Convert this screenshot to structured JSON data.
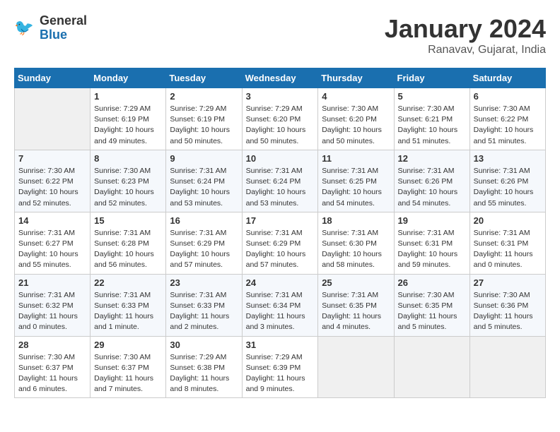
{
  "header": {
    "logo_line1": "General",
    "logo_line2": "Blue",
    "month": "January 2024",
    "location": "Ranavav, Gujarat, India"
  },
  "columns": [
    "Sunday",
    "Monday",
    "Tuesday",
    "Wednesday",
    "Thursday",
    "Friday",
    "Saturday"
  ],
  "weeks": [
    [
      {
        "day": "",
        "info": ""
      },
      {
        "day": "1",
        "info": "Sunrise: 7:29 AM\nSunset: 6:19 PM\nDaylight: 10 hours\nand 49 minutes."
      },
      {
        "day": "2",
        "info": "Sunrise: 7:29 AM\nSunset: 6:19 PM\nDaylight: 10 hours\nand 50 minutes."
      },
      {
        "day": "3",
        "info": "Sunrise: 7:29 AM\nSunset: 6:20 PM\nDaylight: 10 hours\nand 50 minutes."
      },
      {
        "day": "4",
        "info": "Sunrise: 7:30 AM\nSunset: 6:20 PM\nDaylight: 10 hours\nand 50 minutes."
      },
      {
        "day": "5",
        "info": "Sunrise: 7:30 AM\nSunset: 6:21 PM\nDaylight: 10 hours\nand 51 minutes."
      },
      {
        "day": "6",
        "info": "Sunrise: 7:30 AM\nSunset: 6:22 PM\nDaylight: 10 hours\nand 51 minutes."
      }
    ],
    [
      {
        "day": "7",
        "info": "Sunrise: 7:30 AM\nSunset: 6:22 PM\nDaylight: 10 hours\nand 52 minutes."
      },
      {
        "day": "8",
        "info": "Sunrise: 7:30 AM\nSunset: 6:23 PM\nDaylight: 10 hours\nand 52 minutes."
      },
      {
        "day": "9",
        "info": "Sunrise: 7:31 AM\nSunset: 6:24 PM\nDaylight: 10 hours\nand 53 minutes."
      },
      {
        "day": "10",
        "info": "Sunrise: 7:31 AM\nSunset: 6:24 PM\nDaylight: 10 hours\nand 53 minutes."
      },
      {
        "day": "11",
        "info": "Sunrise: 7:31 AM\nSunset: 6:25 PM\nDaylight: 10 hours\nand 54 minutes."
      },
      {
        "day": "12",
        "info": "Sunrise: 7:31 AM\nSunset: 6:26 PM\nDaylight: 10 hours\nand 54 minutes."
      },
      {
        "day": "13",
        "info": "Sunrise: 7:31 AM\nSunset: 6:26 PM\nDaylight: 10 hours\nand 55 minutes."
      }
    ],
    [
      {
        "day": "14",
        "info": "Sunrise: 7:31 AM\nSunset: 6:27 PM\nDaylight: 10 hours\nand 55 minutes."
      },
      {
        "day": "15",
        "info": "Sunrise: 7:31 AM\nSunset: 6:28 PM\nDaylight: 10 hours\nand 56 minutes."
      },
      {
        "day": "16",
        "info": "Sunrise: 7:31 AM\nSunset: 6:29 PM\nDaylight: 10 hours\nand 57 minutes."
      },
      {
        "day": "17",
        "info": "Sunrise: 7:31 AM\nSunset: 6:29 PM\nDaylight: 10 hours\nand 57 minutes."
      },
      {
        "day": "18",
        "info": "Sunrise: 7:31 AM\nSunset: 6:30 PM\nDaylight: 10 hours\nand 58 minutes."
      },
      {
        "day": "19",
        "info": "Sunrise: 7:31 AM\nSunset: 6:31 PM\nDaylight: 10 hours\nand 59 minutes."
      },
      {
        "day": "20",
        "info": "Sunrise: 7:31 AM\nSunset: 6:31 PM\nDaylight: 11 hours\nand 0 minutes."
      }
    ],
    [
      {
        "day": "21",
        "info": "Sunrise: 7:31 AM\nSunset: 6:32 PM\nDaylight: 11 hours\nand 0 minutes."
      },
      {
        "day": "22",
        "info": "Sunrise: 7:31 AM\nSunset: 6:33 PM\nDaylight: 11 hours\nand 1 minute."
      },
      {
        "day": "23",
        "info": "Sunrise: 7:31 AM\nSunset: 6:33 PM\nDaylight: 11 hours\nand 2 minutes."
      },
      {
        "day": "24",
        "info": "Sunrise: 7:31 AM\nSunset: 6:34 PM\nDaylight: 11 hours\nand 3 minutes."
      },
      {
        "day": "25",
        "info": "Sunrise: 7:31 AM\nSunset: 6:35 PM\nDaylight: 11 hours\nand 4 minutes."
      },
      {
        "day": "26",
        "info": "Sunrise: 7:30 AM\nSunset: 6:35 PM\nDaylight: 11 hours\nand 5 minutes."
      },
      {
        "day": "27",
        "info": "Sunrise: 7:30 AM\nSunset: 6:36 PM\nDaylight: 11 hours\nand 5 minutes."
      }
    ],
    [
      {
        "day": "28",
        "info": "Sunrise: 7:30 AM\nSunset: 6:37 PM\nDaylight: 11 hours\nand 6 minutes."
      },
      {
        "day": "29",
        "info": "Sunrise: 7:30 AM\nSunset: 6:37 PM\nDaylight: 11 hours\nand 7 minutes."
      },
      {
        "day": "30",
        "info": "Sunrise: 7:29 AM\nSunset: 6:38 PM\nDaylight: 11 hours\nand 8 minutes."
      },
      {
        "day": "31",
        "info": "Sunrise: 7:29 AM\nSunset: 6:39 PM\nDaylight: 11 hours\nand 9 minutes."
      },
      {
        "day": "",
        "info": ""
      },
      {
        "day": "",
        "info": ""
      },
      {
        "day": "",
        "info": ""
      }
    ]
  ]
}
